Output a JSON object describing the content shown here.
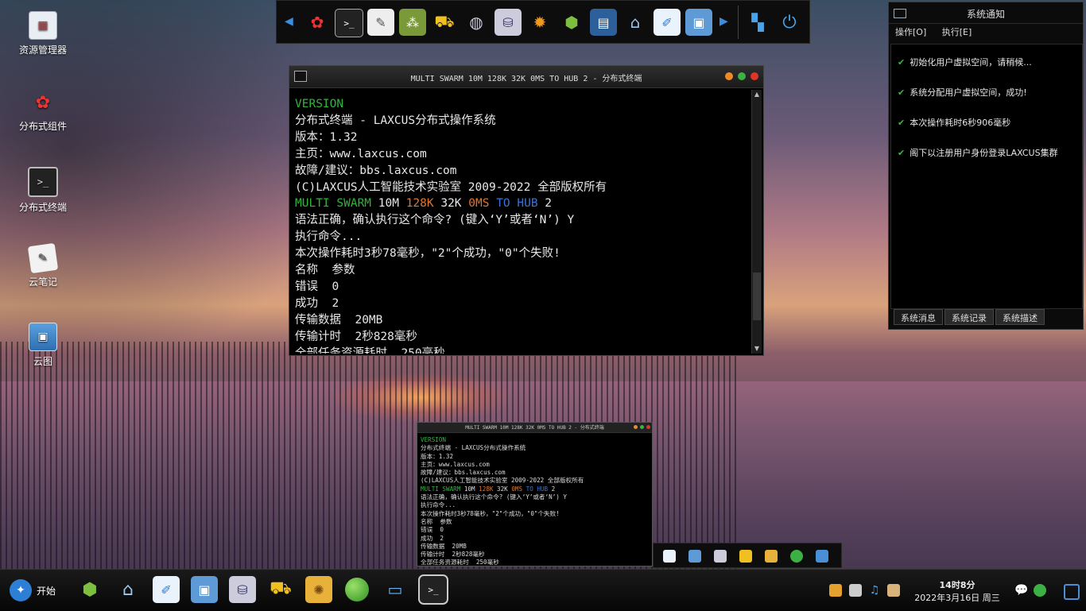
{
  "desktop": {
    "icons": [
      {
        "label": "资源管理器",
        "icon": "resource-manager-icon"
      },
      {
        "label": "分布式组件",
        "icon": "distributed-component-icon"
      },
      {
        "label": "分布式终端",
        "icon": "distributed-terminal-icon"
      },
      {
        "label": "云笔记",
        "icon": "cloud-note-icon"
      },
      {
        "label": "云图",
        "icon": "cloud-image-icon"
      }
    ]
  },
  "dock": {
    "items": [
      "components-icon",
      "terminal-icon",
      "notepad-icon",
      "network-icon",
      "forklift-icon",
      "planet-icon",
      "database-icon",
      "ladybug-icon",
      "cube-icon",
      "film-icon",
      "home-icon",
      "paint-icon",
      "picture-icon"
    ],
    "extras": [
      "switch-icon",
      "power-icon"
    ]
  },
  "terminal": {
    "title": "MULTI SWARM 10M 128K 32K 0MS TO HUB 2 - 分布式终端",
    "lines": {
      "l1": "VERSION",
      "l2": "分布式终端 - LAXCUS分布式操作系统",
      "l3": "版本：1.32",
      "l4": "主页：www.laxcus.com",
      "l5": "故障/建议：bbs.laxcus.com",
      "l6": "(C)LAXCUS人工智能技术实验室 2009-2022 全部版权所有",
      "l7a": "MULTI SWARM ",
      "l7b": "10M ",
      "l7c": "128K ",
      "l7d": "32K ",
      "l7e": "0MS ",
      "l7f": "TO HUB ",
      "l7g": "2",
      "l8": "语法正确，确认执行这个命令? (键入‘Y’或者‘N’) Y",
      "l9": "执行命令...",
      "l10": "本次操作耗时3秒78毫秒，\"2\"个成功，\"0\"个失败!",
      "l11": "名称  参数",
      "l12": "错误  0",
      "l13": "成功  2",
      "l14": "传输数据  20MB",
      "l15": "传输计时  2秒828毫秒",
      "l16": "全部任务资源耗时  250毫秒"
    }
  },
  "notify": {
    "title": "系统通知",
    "menu": {
      "op": "操作[O]",
      "exec": "执行[E]"
    },
    "messages": [
      "初始化用户虚拟空间，请稍候...",
      "系统分配用户虚拟空间，成功!",
      "本次操作耗时6秒906毫秒",
      "阁下以注册用户身份登录LAXCUS集群"
    ],
    "tabs": [
      "系统消息",
      "系统记录",
      "系统描述"
    ]
  },
  "taskbar": {
    "start_label": "开始",
    "apps": [
      "cube-icon",
      "home-icon",
      "paint-icon",
      "picture-icon",
      "database-icon",
      "forklift-icon",
      "sunflower-icon",
      "green-ball-icon",
      "monitor-icon",
      "terminal-icon"
    ],
    "clock_time": "14时8分",
    "clock_date": "2022年3月16日 周三"
  },
  "colors": {
    "accent_green": "#2fb53a",
    "accent_orange": "#e0752d",
    "accent_blue": "#3b74d9"
  }
}
